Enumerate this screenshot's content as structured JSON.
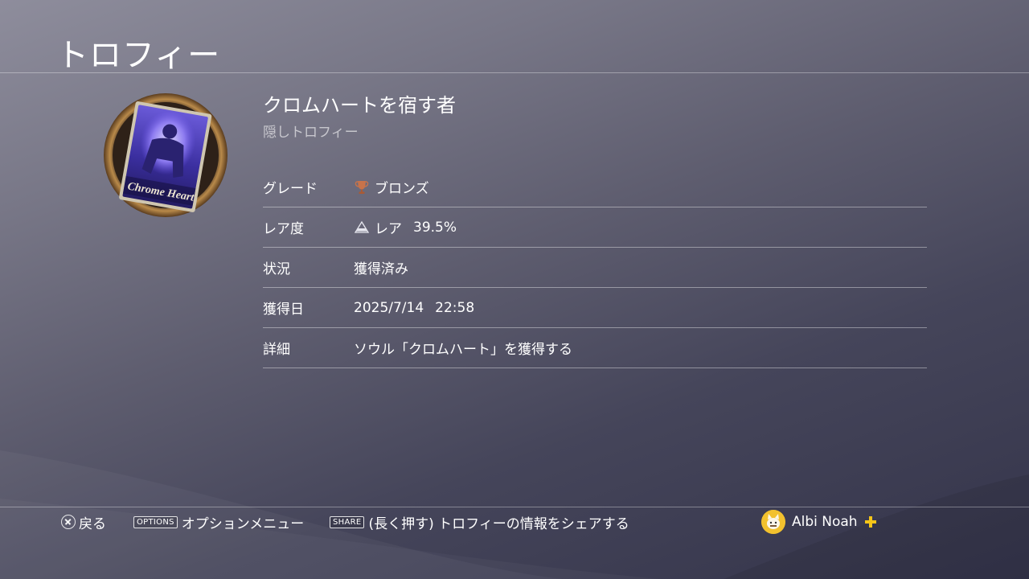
{
  "header": {
    "title": "トロフィー"
  },
  "trophy": {
    "name": "クロムハートを宿す者",
    "subtitle": "隠しトロフィー",
    "image_text": "Chrome Heart",
    "image_icon": "chrome-heart-trophy-icon"
  },
  "details": [
    {
      "label": "グレード",
      "icon": "bronze-trophy-icon",
      "value": "ブロンズ",
      "extra": ""
    },
    {
      "label": "レア度",
      "icon": "rarity-pyramid-icon",
      "value": "レア",
      "extra": "39.5%"
    },
    {
      "label": "状況",
      "icon": "",
      "value": "獲得済み",
      "extra": ""
    },
    {
      "label": "獲得日",
      "icon": "",
      "value": "2025/7/14",
      "extra": "22:58"
    },
    {
      "label": "詳細",
      "icon": "",
      "value": "ソウル「クロムハート」を獲得する",
      "extra": ""
    }
  ],
  "footer": {
    "back_label": "戻る",
    "options_key": "OPTIONS",
    "options_label": "オプションメニュー",
    "share_key": "SHARE",
    "share_label": "(長く押す) トロフィーの情報をシェアする",
    "username": "Albi Noah"
  },
  "colors": {
    "bronze": "#c8734a",
    "plus": "#f5c518",
    "avatar": "#f2c12e"
  }
}
